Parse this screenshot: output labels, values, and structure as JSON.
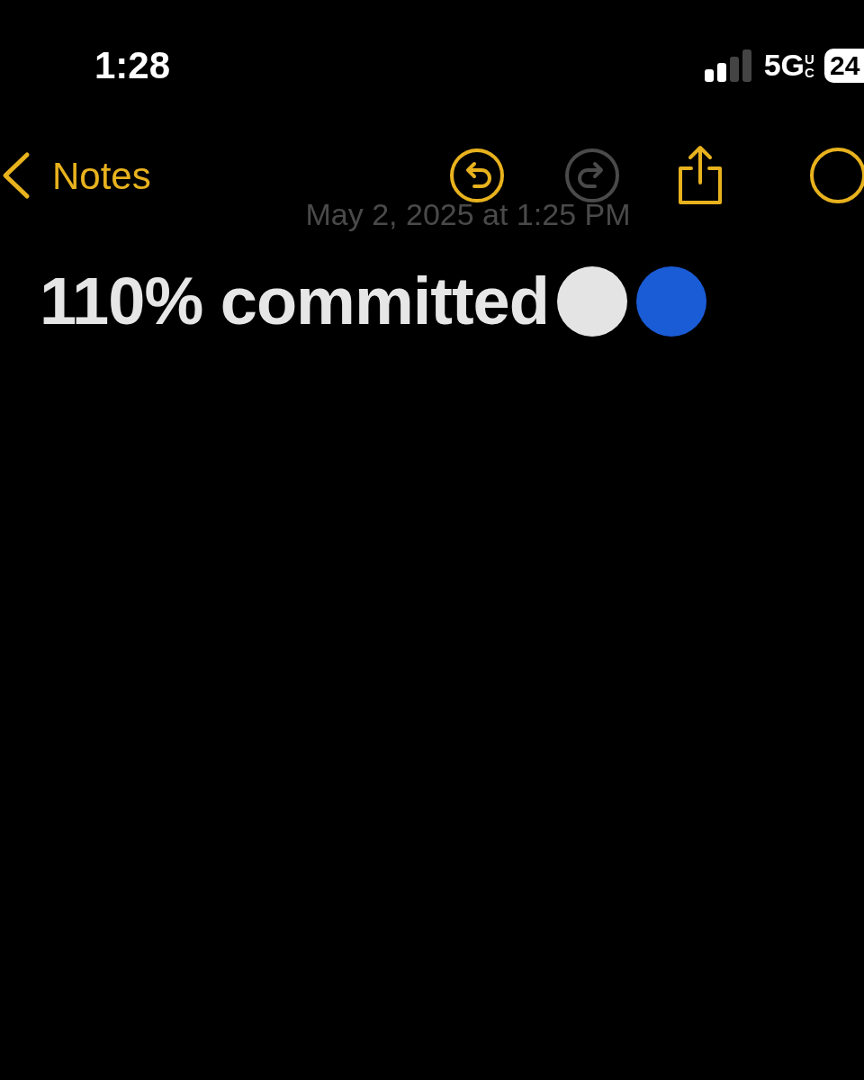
{
  "status_bar": {
    "time": "1:28",
    "network": "5G",
    "network_suffix": "UC",
    "battery": "24"
  },
  "nav_bar": {
    "back_label": "Notes",
    "actions": [
      {
        "kind": "undo",
        "disabled": false
      },
      {
        "kind": "redo",
        "disabled": true
      },
      {
        "kind": "share",
        "disabled": false
      },
      {
        "kind": "more",
        "disabled": false
      }
    ]
  },
  "note": {
    "date": "May 2, 2025 at 1:25 PM",
    "title": "110% committed",
    "emoji": [
      {
        "color": "#e4e4e4"
      },
      {
        "color": "#1a5cd6"
      }
    ]
  }
}
